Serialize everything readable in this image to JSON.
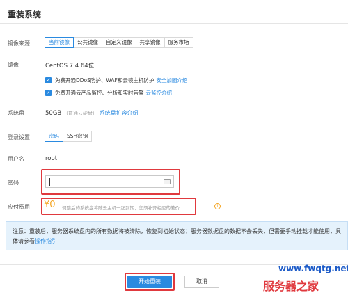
{
  "dialog": {
    "title": "重装系统"
  },
  "image_source": {
    "label": "镜像来源",
    "tabs": [
      "当前镜像",
      "公共镜像",
      "自定义镜像",
      "共享镜像",
      "服务市场"
    ],
    "active_index": 0
  },
  "image": {
    "label": "镜像",
    "value": "CentOS 7.4 64位",
    "options": [
      {
        "text": "免费开通DDoS防护、WAF和云镜主机防护",
        "link": "安全加固介绍",
        "checked": true
      },
      {
        "text": "免费开通云产品监控、分析和实时告警",
        "link": "云监控介绍",
        "checked": true
      }
    ]
  },
  "system_disk": {
    "label": "系统盘",
    "size": "50GB",
    "type": "（普通云硬盘）",
    "link": "系统盘扩容介绍"
  },
  "login": {
    "label": "登录设置",
    "tabs": [
      "密码",
      "SSH密钥"
    ],
    "active_index": 0
  },
  "username": {
    "label": "用户名",
    "value": "root"
  },
  "password": {
    "label": "密码",
    "value": ""
  },
  "fee": {
    "label": "应付费用",
    "amount": "¥0",
    "note": "调整后的系统盘将随云主机一起到期，您须补齐相应的差价"
  },
  "notice": {
    "text": "注意：重装后，服务器系统盘内的所有数据将被清除，恢复到初始状态；服务器数据盘的数据不会丢失，但需要手动挂载才能使用，具体请参看",
    "link": "操作指引"
  },
  "buttons": {
    "confirm": "开始重装",
    "cancel": "取消"
  },
  "watermark": {
    "url": "www.fwqtg.net",
    "text": "服务器之家"
  },
  "colors": {
    "primary": "#2a8ae0",
    "highlight": "#e0393e",
    "fee": "#f5a623"
  }
}
